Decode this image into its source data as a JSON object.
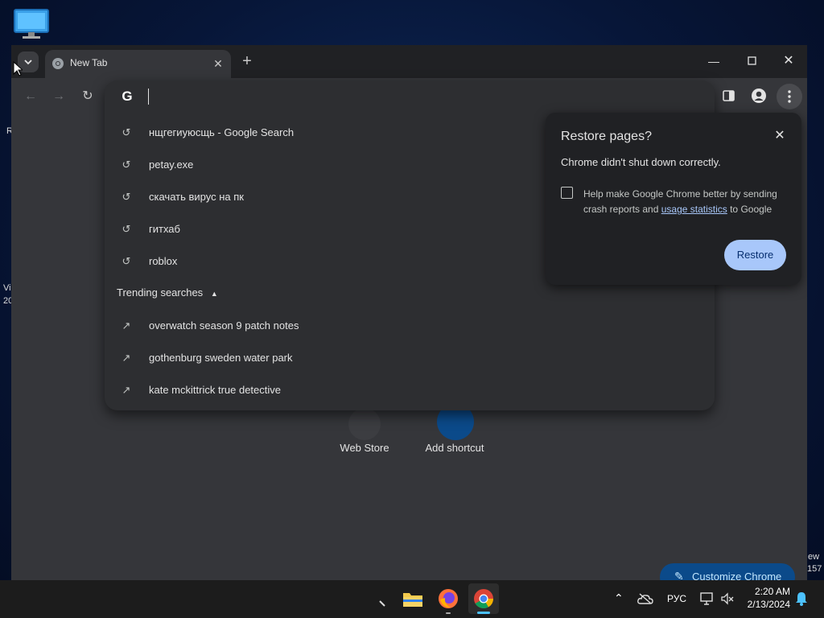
{
  "desktop": {
    "left_fragments": [
      "R",
      "Vi",
      "20"
    ],
    "right_fragments": [
      "ew",
      "157"
    ]
  },
  "browser": {
    "tab": {
      "title": "New Tab"
    },
    "omnibox": {
      "history": [
        "нщгегиуюсщь - Google Search",
        "petay.exe",
        "скачать вирус на пк",
        "гитхаб",
        "roblox"
      ],
      "trending_header": "Trending searches",
      "trending": [
        "overwatch season 9 patch notes",
        "gothenburg sweden water park",
        "kate mckittrick true detective"
      ]
    },
    "shortcuts": [
      {
        "label": "Web Store"
      },
      {
        "label": "Add shortcut"
      }
    ],
    "customize_label": "Customize Chrome",
    "restore_bubble": {
      "title": "Restore pages?",
      "message": "Chrome didn't shut down correctly.",
      "help_text_before": "Help make Google Chrome better by sending crash reports and ",
      "help_link": "usage statistics",
      "help_text_after": " to Google",
      "restore_label": "Restore"
    }
  },
  "taskbar": {
    "language": "РУС",
    "time": "2:20 AM",
    "date": "2/13/2024"
  },
  "colors": {
    "accent": "#a8c7fa",
    "window_bg": "#35363a",
    "dropdown_bg": "#2d2e31",
    "taskbar_bg": "#1c1c1c"
  }
}
